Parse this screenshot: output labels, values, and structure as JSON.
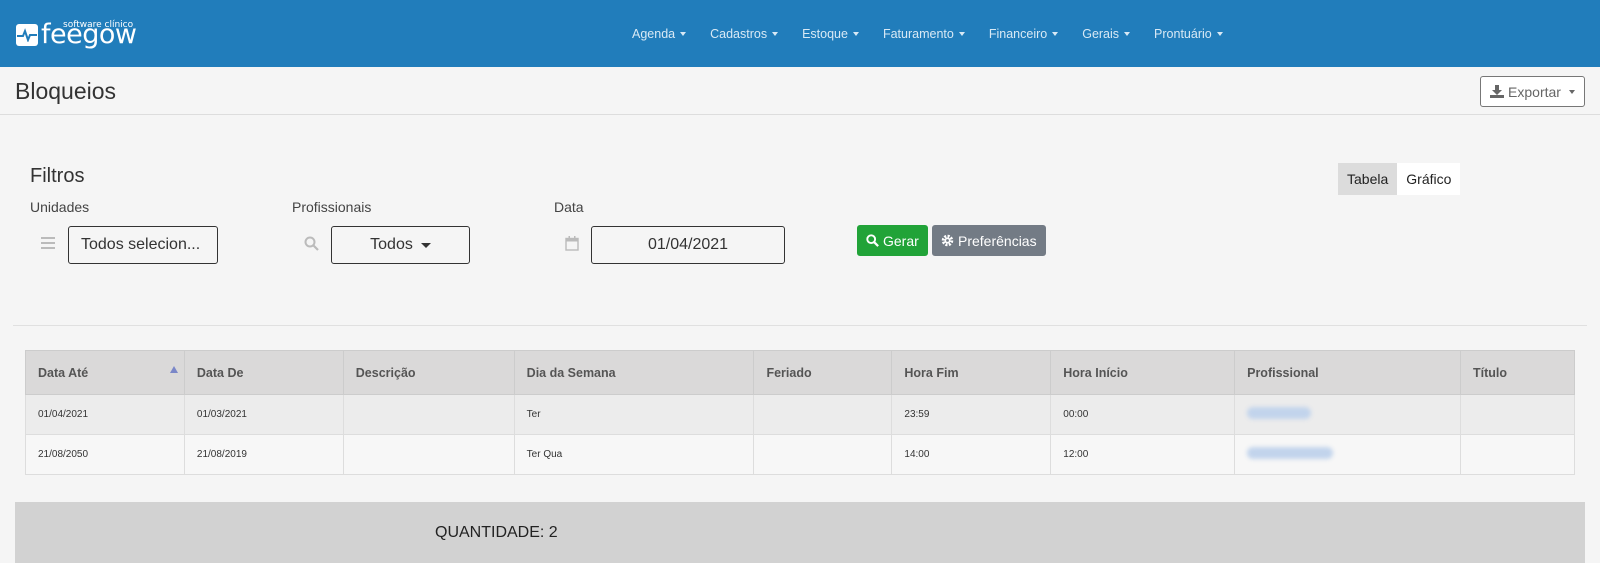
{
  "brand": {
    "tagline": "software clínico",
    "name": "feegow"
  },
  "nav": [
    {
      "label": "Agenda",
      "name": "nav-agenda"
    },
    {
      "label": "Cadastros",
      "name": "nav-cadastros"
    },
    {
      "label": "Estoque",
      "name": "nav-estoque"
    },
    {
      "label": "Faturamento",
      "name": "nav-faturamento"
    },
    {
      "label": "Financeiro",
      "name": "nav-financeiro"
    },
    {
      "label": "Gerais",
      "name": "nav-gerais"
    },
    {
      "label": "Prontuário",
      "name": "nav-prontuario"
    }
  ],
  "page": {
    "title": "Bloqueios",
    "export_label": "Exportar"
  },
  "filters": {
    "title": "Filtros",
    "unidades_label": "Unidades",
    "unidades_value": "Todos selecion...",
    "profissionais_label": "Profissionais",
    "profissionais_value": "Todos",
    "data_label": "Data",
    "data_value": "01/04/2021",
    "gerar_label": "Gerar",
    "preferencias_label": "Preferências"
  },
  "view_toggle": {
    "table": "Tabela",
    "chart": "Gráfico",
    "active": "Tabela"
  },
  "table": {
    "headers": [
      "Data Até",
      "Data De",
      "Descrição",
      "Dia da Semana",
      "Feriado",
      "Hora Fim",
      "Hora Início",
      "Profissional",
      "Título"
    ],
    "rows": [
      [
        "01/04/2021",
        "01/03/2021",
        "",
        "Ter",
        "",
        "23:59",
        "00:00",
        "",
        ""
      ],
      [
        "21/08/2050",
        "21/08/2019",
        "",
        "Ter Qua",
        "",
        "14:00",
        "12:00",
        "",
        ""
      ]
    ]
  },
  "summary": {
    "quantity": "QUANTIDADE: 2"
  },
  "colors": {
    "navbar": "#217dbb",
    "gerar": "#21a338",
    "preferencias": "#737b85"
  }
}
